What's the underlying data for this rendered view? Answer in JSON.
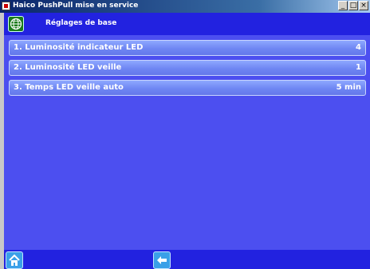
{
  "window": {
    "title": "Haico PushPull mise en service",
    "controls": [
      "_",
      "□",
      "×"
    ]
  },
  "header": {
    "title": "Réglages de base",
    "icon": "globe-icon"
  },
  "settings": [
    {
      "label": "1. Luminosité indicateur LED",
      "value": "4"
    },
    {
      "label": "2. Luminosité LED veille",
      "value": "1"
    },
    {
      "label": "3. Temps LED veille auto",
      "value": "5 min"
    }
  ],
  "footer": {
    "home_icon": "home-icon",
    "back_icon": "back-arrow-icon"
  },
  "colors": {
    "background": "#4c4ff0",
    "header": "#2222e0",
    "row": "#7a90f5",
    "button": "#3aa0e8"
  }
}
